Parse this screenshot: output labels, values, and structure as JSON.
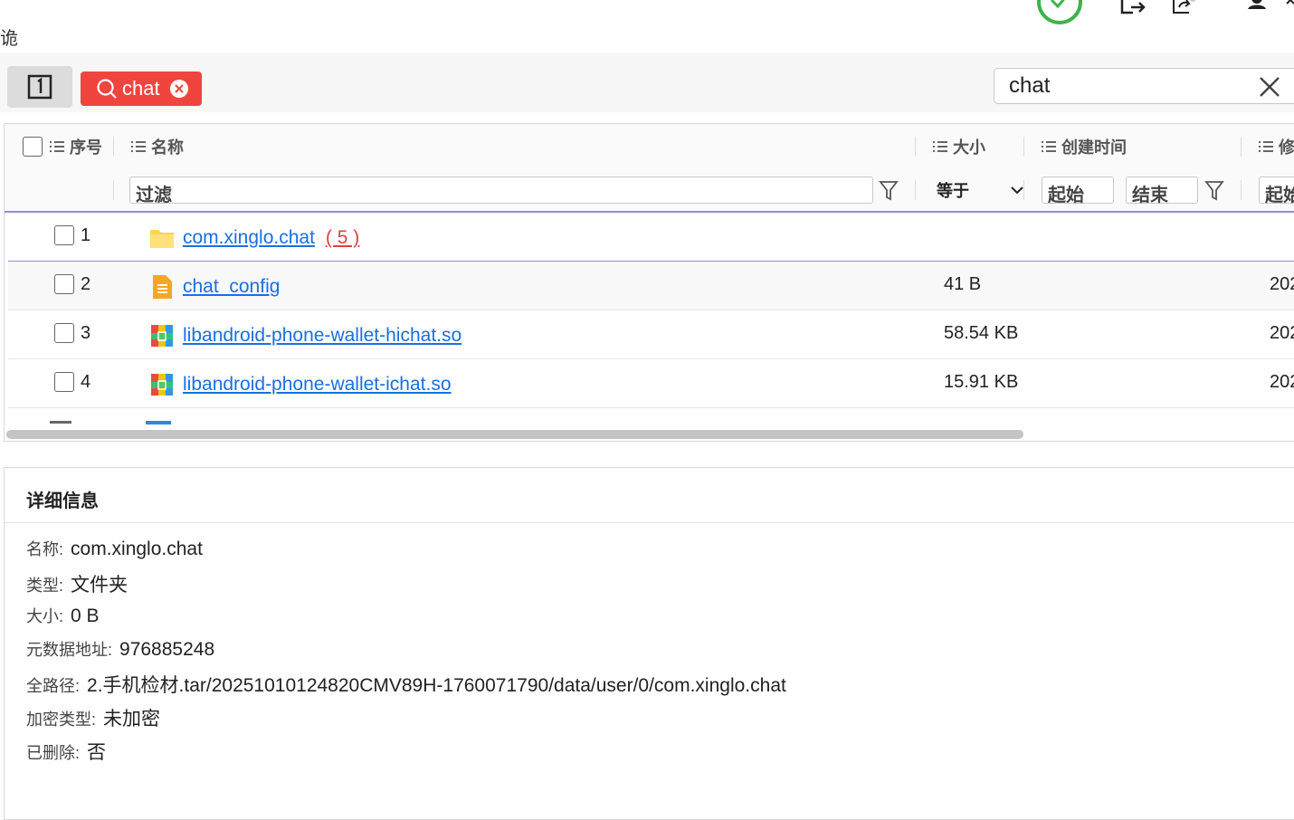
{
  "top": {
    "cut_char": "诡",
    "icons": [
      "shield-check-icon",
      "export-icon",
      "clipboard-share-icon",
      "user-icon",
      "close-icon"
    ]
  },
  "tagbar": {
    "search_tag_label": "chat",
    "search_value": "chat",
    "accent": "#f0443e"
  },
  "table": {
    "columns": {
      "index": "序号",
      "name": "名称",
      "size": "大小",
      "created": "创建时间",
      "modified": "修"
    },
    "filters": {
      "name_placeholder": "过滤",
      "size_operator": "等于",
      "created_start": "起始",
      "created_end": "结束",
      "modified_start": "起始"
    },
    "rows": [
      {
        "num": "1",
        "name": "com.xinglo.chat",
        "count": "( 5 )",
        "type": "folder",
        "size": "",
        "created": ""
      },
      {
        "num": "2",
        "name": "chat_config",
        "count": "",
        "type": "doc",
        "size": "41 B",
        "created": "202"
      },
      {
        "num": "3",
        "name": "libandroid-phone-wallet-hichat.so",
        "count": "",
        "type": "archive",
        "size": "58.54 KB",
        "created": "202"
      },
      {
        "num": "4",
        "name": "libandroid-phone-wallet-ichat.so",
        "count": "",
        "type": "archive",
        "size": "15.91 KB",
        "created": "202"
      }
    ]
  },
  "details": {
    "title": "详细信息",
    "fields": [
      {
        "label": "名称:",
        "value": "com.xinglo.chat"
      },
      {
        "label": "类型:",
        "value": "文件夹"
      },
      {
        "label": "大小:",
        "value": "0 B"
      },
      {
        "label": "元数据地址:",
        "value": "976885248"
      },
      {
        "label": "全路径:",
        "value": "2.手机检材.tar/20251010124820CMV89H-1760071790/data/user/0/com.xinglo.chat"
      },
      {
        "label": "加密类型:",
        "value": "未加密"
      },
      {
        "label": "已删除:",
        "value": "否"
      }
    ]
  }
}
